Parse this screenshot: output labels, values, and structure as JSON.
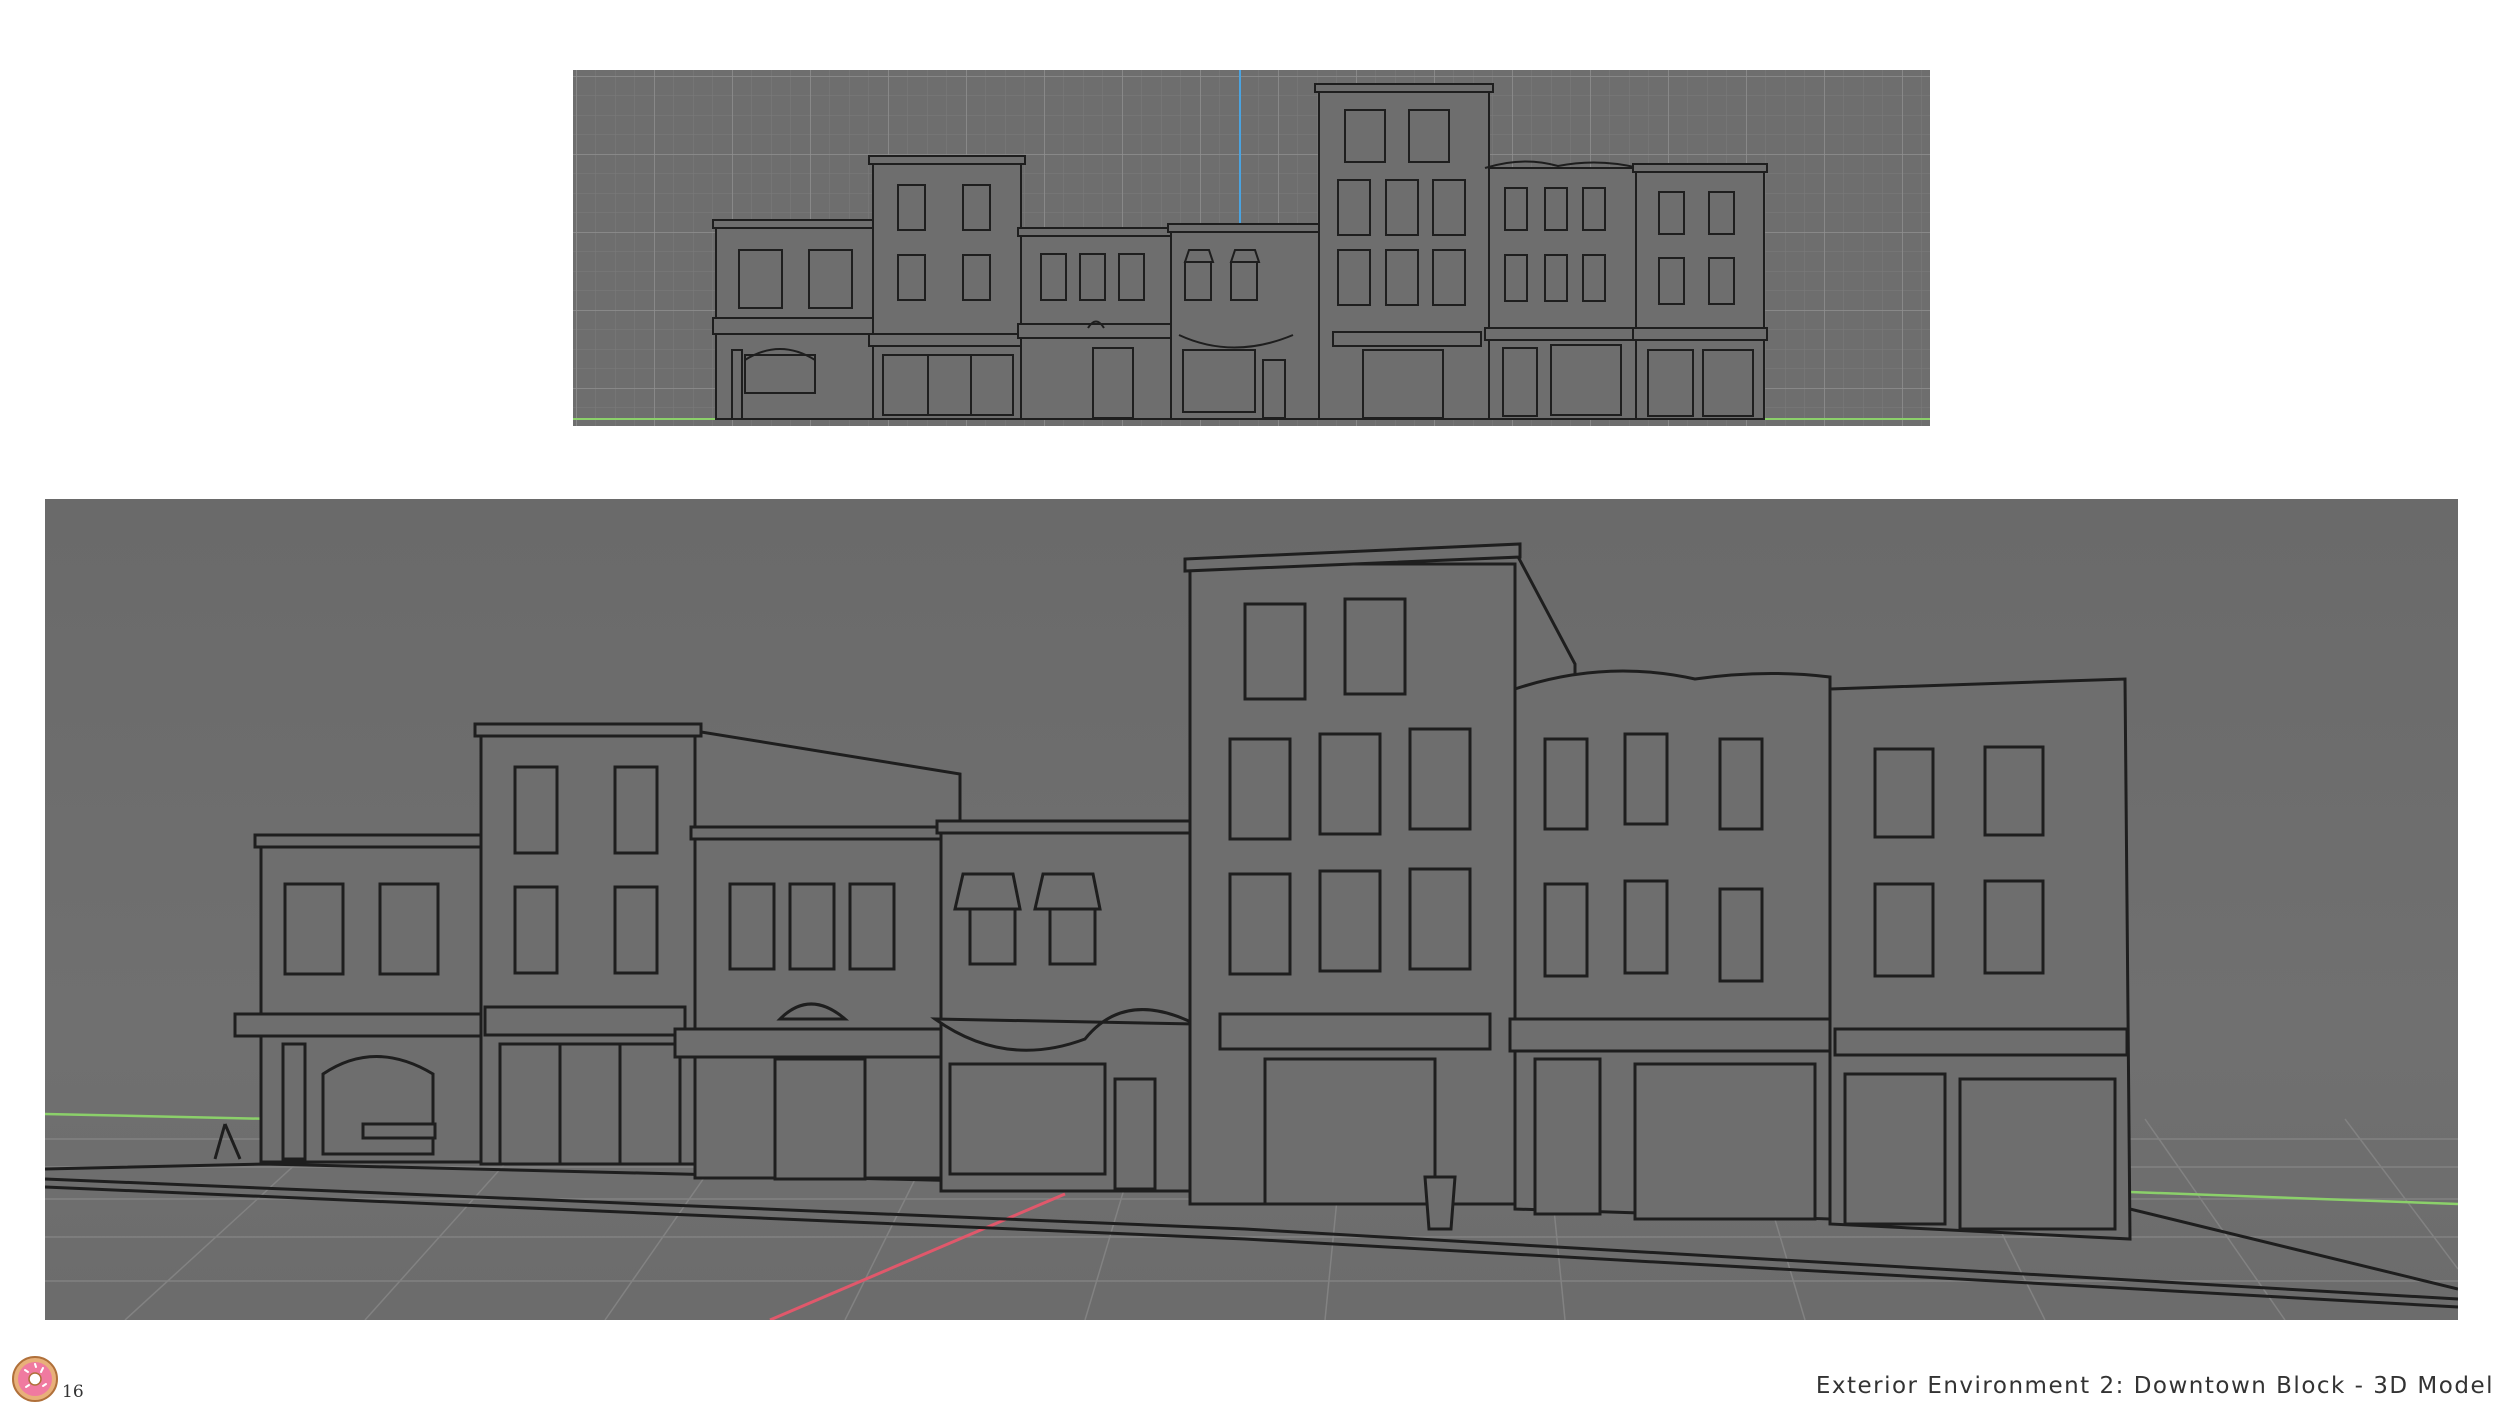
{
  "slide": {
    "page_number": "16",
    "title": "Exterior Environment 2: Downtown Block - 3D Model"
  },
  "viewports": {
    "top": {
      "view": "orthographic-front",
      "content": "building-facades-wireframe"
    },
    "bottom": {
      "view": "perspective",
      "content": "building-facades-wireframe"
    }
  },
  "icons": {
    "footer_logo": "donut-icon"
  },
  "colors": {
    "viewport_bg": "#6e6e6e",
    "grid_line": "#8a8a8a",
    "wire": "#1e1e1e",
    "axis_x": "#e0586b",
    "axis_z": "#8bd06a",
    "axis_y": "#4aa3e0",
    "donut_dough": "#e8b07a",
    "donut_frosting": "#f07aa0"
  }
}
